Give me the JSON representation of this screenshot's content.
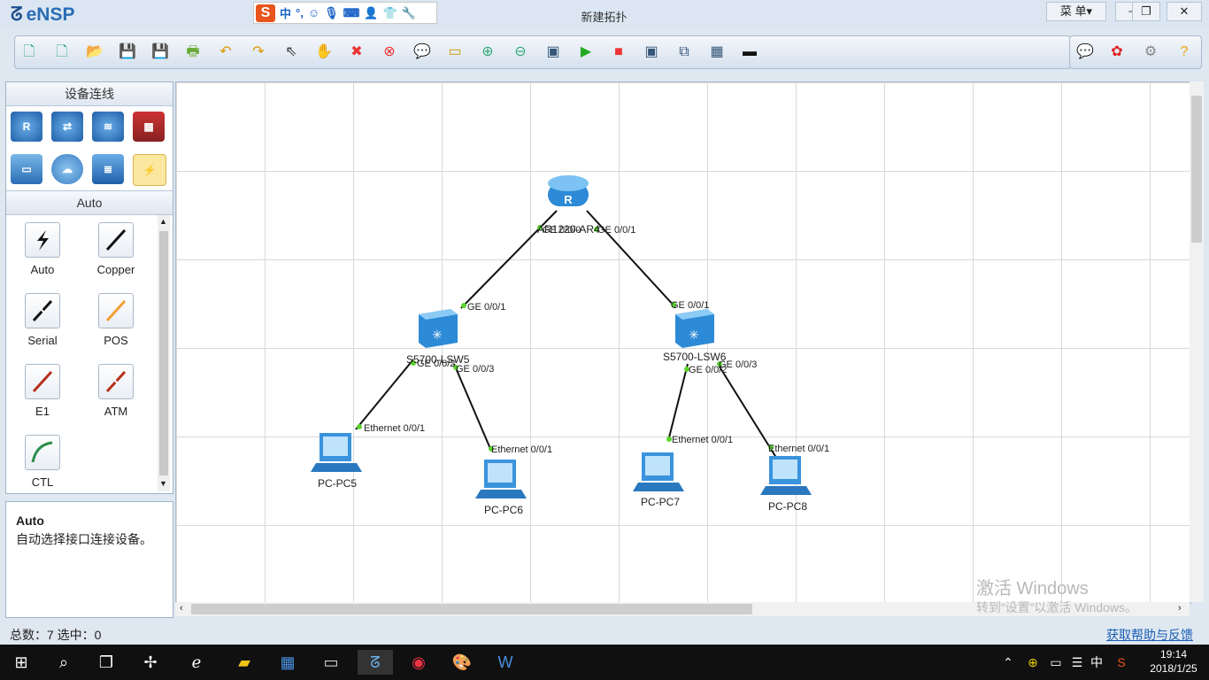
{
  "app": {
    "logo_text": "eNSP",
    "window_title": "新建拓扑"
  },
  "ime_bar": {
    "logo": "S",
    "mode": "中",
    "punct": "°,"
  },
  "window_controls": {
    "menu_label": "菜 单▾",
    "minimize": "─",
    "restore": "❐",
    "close": "✕"
  },
  "toolbar": {
    "items": [
      "new-topology",
      "new-lab",
      "open",
      "save",
      "save-as",
      "print",
      "undo",
      "redo",
      "select",
      "pan",
      "delete",
      "delete-link",
      "text",
      "palette",
      "zoom-in",
      "zoom-out",
      "fit",
      "start-device",
      "stop-device",
      "capture",
      "topology",
      "grid",
      "cli"
    ],
    "right_items": [
      "chat",
      "huawei",
      "settings",
      "help"
    ]
  },
  "left_panel": {
    "device_header": "设备连线",
    "device_categories": [
      "router",
      "switch",
      "wireless",
      "firewall",
      "pc",
      "cloud",
      "other-device",
      "connection"
    ],
    "cable_header": "Auto",
    "cables": [
      {
        "label": "Auto",
        "color": "#111111"
      },
      {
        "label": "Copper",
        "color": "#111111"
      },
      {
        "label": "Serial",
        "color": "#111111"
      },
      {
        "label": "POS",
        "color": "#f0a033"
      },
      {
        "label": "E1",
        "color": "#b5301a"
      },
      {
        "label": "ATM",
        "color": "#b5301a"
      },
      {
        "label": "CTL",
        "color": "#2f8f4a"
      }
    ],
    "description": {
      "title": "Auto",
      "text": "自动选择接口连接设备。"
    }
  },
  "topology": {
    "nodes": {
      "router": {
        "name": "AR1220-AR4",
        "type": "router"
      },
      "lsw5": {
        "name": "S5700-LSW5",
        "type": "switch"
      },
      "lsw6": {
        "name": "S5700-LSW6",
        "type": "switch"
      },
      "pc5": {
        "name": "PC-PC5",
        "type": "pc"
      },
      "pc6": {
        "name": "PC-PC6",
        "type": "pc"
      },
      "pc7": {
        "name": "PC-PC7",
        "type": "pc"
      },
      "pc8": {
        "name": "PC-PC8",
        "type": "pc"
      }
    },
    "ports": {
      "r_ge000": "GE 0/0/0",
      "r_ge001": "GE 0/0/1",
      "sw5_up": "GE 0/0/1",
      "sw5_p2": "GE 0/0/2",
      "sw5_p3": "GE 0/0/3",
      "sw6_up": "GE 0/0/1",
      "sw6_p2": "GE 0/0/2",
      "sw6_p3": "GE 0/0/3",
      "pc5_eth": "Ethernet 0/0/1",
      "pc6_eth": "Ethernet 0/0/1",
      "pc7_eth": "Ethernet 0/0/1",
      "pc8_eth": "Ethernet 0/0/1"
    }
  },
  "watermark": {
    "line1": "激活 Windows",
    "line2": "转到“设置”以激活 Windows。"
  },
  "status": {
    "counts": "总数：7  选中：0",
    "help_link": "获取帮助与反馈"
  },
  "taskbar": {
    "tray_ime": "中",
    "time": "19:14",
    "date": "2018/1/25"
  }
}
